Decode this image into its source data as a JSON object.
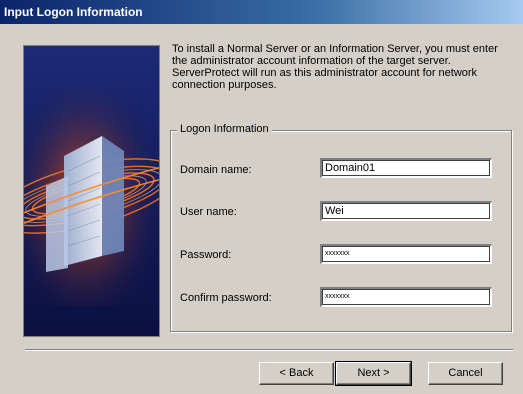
{
  "window": {
    "title": "Input Logon Information"
  },
  "intro_text": "To install a Normal Server or an Information Server, you must enter the administrator account information of the target server. ServerProtect will run as this administrator account for network connection purposes.",
  "logon_group": {
    "legend": "Logon Information",
    "domain": {
      "label": "Domain name:",
      "value": "Domain01"
    },
    "user": {
      "label": "User name:",
      "value": "Wei"
    },
    "password": {
      "label": "Password:",
      "value": "xxxxxxx"
    },
    "confirm": {
      "label": "Confirm password:",
      "value": "xxxxxxx"
    }
  },
  "buttons": {
    "back": "< Back",
    "next": "Next >",
    "cancel": "Cancel"
  },
  "colors": {
    "titlebar": "#0a246a",
    "dialog_bg": "#d4d0c8",
    "banner_bg": "#10164a",
    "ring_accent": "#ff8a2a"
  }
}
